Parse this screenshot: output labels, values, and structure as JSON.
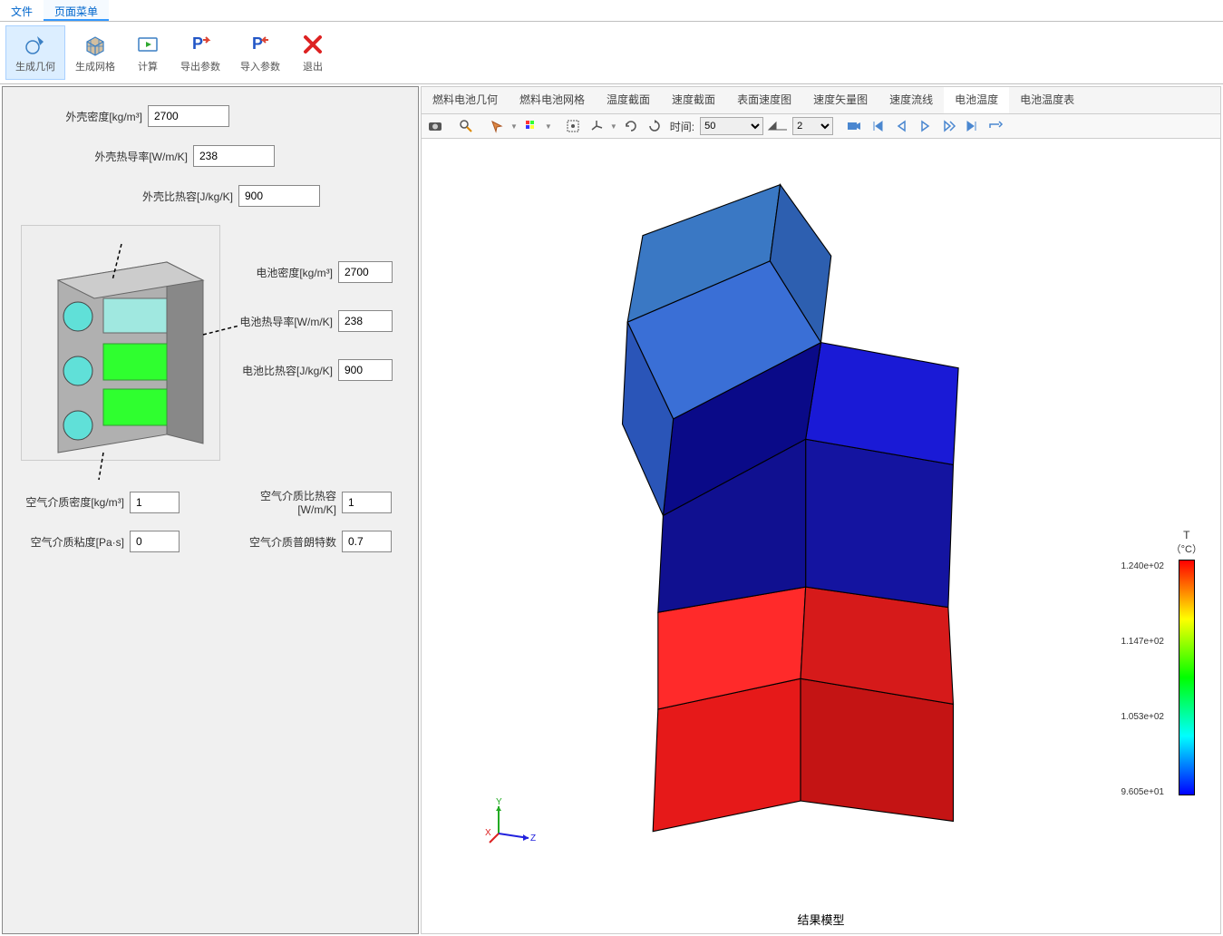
{
  "top_menu": {
    "file": "文件",
    "page_menu": "页面菜单"
  },
  "ribbon": {
    "gen_geom": "生成几何",
    "gen_mesh": "生成网格",
    "compute": "计算",
    "export_params": "导出参数",
    "import_params": "导入参数",
    "exit": "退出"
  },
  "form": {
    "shell_density_label": "外壳密度[kg/m³]",
    "shell_density_value": "2700",
    "shell_k_label": "外壳热导率[W/m/K]",
    "shell_k_value": "238",
    "shell_cp_label": "外壳比热容[J/kg/K]",
    "shell_cp_value": "900",
    "cell_density_label": "电池密度[kg/m³]",
    "cell_density_value": "2700",
    "cell_k_label": "电池热导率[W/m/K]",
    "cell_k_value": "238",
    "cell_cp_label": "电池比热容[J/kg/K]",
    "cell_cp_value": "900",
    "air_density_label": "空气介质密度[kg/m³]",
    "air_density_value": "1",
    "air_cp_label": "空气介质比热容[W/m/K]",
    "air_cp_value": "1",
    "air_visc_label": "空气介质粘度[Pa·s]",
    "air_visc_value": "0",
    "air_pr_label": "空气介质普朗特数",
    "air_pr_value": "0.7"
  },
  "view_tabs": {
    "fc_geom": "燃料电池几何",
    "fc_mesh": "燃料电池网格",
    "temp_section": "温度截面",
    "vel_section": "速度截面",
    "surf_vel": "表面速度图",
    "vel_vector": "速度矢量图",
    "vel_stream": "速度流线",
    "cell_temp": "电池温度",
    "cell_temp_table": "电池温度表"
  },
  "viewer": {
    "time_label": "时间:",
    "time_value": "50",
    "frame_value": "2",
    "result_label": "结果模型"
  },
  "colorbar": {
    "title": "T",
    "unit": "（°C）",
    "ticks": [
      "1.240e+02",
      "1.147e+02",
      "1.053e+02",
      "9.605e+01"
    ]
  },
  "chart_data": {
    "type": "3d-contour",
    "variable": "T",
    "unit": "°C",
    "range_min": 96.05,
    "range_max": 124.0,
    "time": 50,
    "description": "Six cuboid battery cells colored by temperature; bottom row ~124°C (red), middle-right ~100-110°C (blue/dark blue), top-left cell ~105-110°C (medium blue)."
  }
}
